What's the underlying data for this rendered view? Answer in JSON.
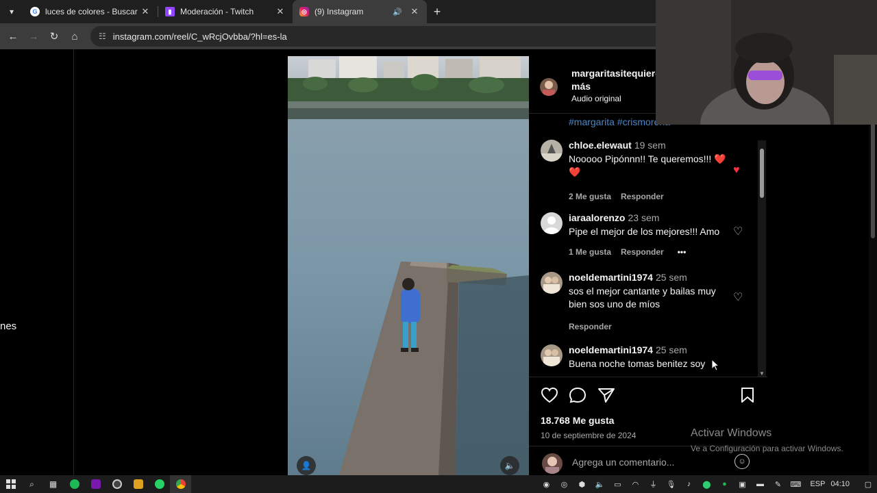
{
  "browser": {
    "tabs": [
      {
        "title": "luces de colores - Buscar con Google",
        "favicon": "google-icon",
        "active": false
      },
      {
        "title": "Moderación - Twitch",
        "favicon": "twitch-icon",
        "active": false
      },
      {
        "title": "(9) Instagram",
        "favicon": "instagram-icon",
        "active": true
      }
    ],
    "url": "instagram.com/reel/C_wRcjOvbba/?hl=es-la"
  },
  "left_panel": {
    "clipped_text": "nes"
  },
  "post": {
    "author": {
      "username": "margaritasitequiero",
      "more_label": "más",
      "audio": "Audio original"
    },
    "hashtags": "#margarita #crismorena",
    "comments": [
      {
        "username": "chloe.elewaut",
        "age": "19 sem",
        "text": "Nooooo Pipónnn!! Te queremos!!! ❤️❤️",
        "likes": "2 Me gusta",
        "reply": "Responder",
        "liked": true
      },
      {
        "username": "iaraalorenzo",
        "age": "23 sem",
        "text": "Pipe el mejor de los mejores!!! Amo",
        "likes": "1 Me gusta",
        "reply": "Responder",
        "more": "•••",
        "liked": false
      },
      {
        "username": "noeldemartini1974",
        "age": "25 sem",
        "text": "sos el mejor cantante y bailas muy bien sos uno de míos",
        "reply": "Responder",
        "liked": false
      },
      {
        "username": "noeldemartini1974",
        "age": "25 sem",
        "text": "Buena noche tomas benitez soy",
        "liked": false
      }
    ],
    "likes_count": "18.768 Me gusta",
    "date": "10 de septiembre de 2024",
    "comment_placeholder": "Agrega un comentario..."
  },
  "windows_watermark": {
    "title": "Activar Windows",
    "subtitle": "Ve a Configuración para activar Windows."
  },
  "taskbar": {
    "language": "ESP",
    "time": "04:10"
  },
  "colors": {
    "like_red": "#ff3040",
    "hashtag_blue": "#4a86c8",
    "browser_dark": "#1f1f1f"
  }
}
